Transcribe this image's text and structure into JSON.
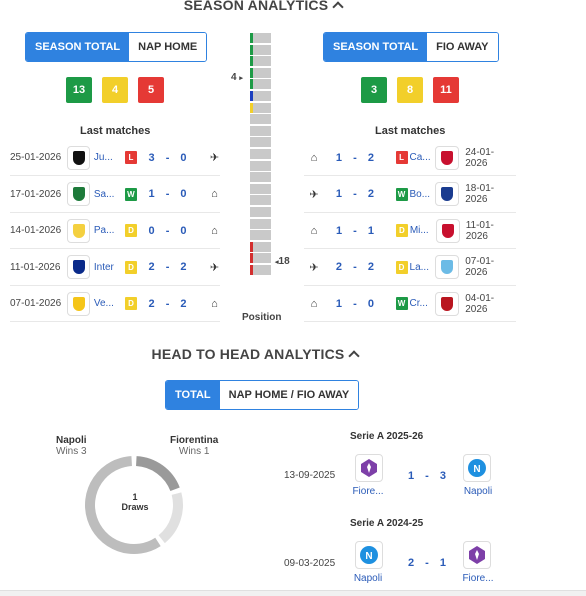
{
  "season": {
    "title": "SEASON ANALYTICS",
    "left": {
      "tabs": [
        "SEASON TOTAL",
        "NAP HOME"
      ],
      "badges": [
        {
          "value": "13",
          "color": "#1d9a46"
        },
        {
          "value": "4",
          "color": "#f2cf2a"
        },
        {
          "value": "5",
          "color": "#e53935"
        }
      ],
      "last_matches_label": "Last matches",
      "matches": [
        {
          "date": "25-01-2026",
          "team": "Ju...",
          "result": "L",
          "score": "3 - 0",
          "venue": "airplane-icon"
        },
        {
          "date": "17-01-2026",
          "team": "Sa...",
          "result": "W",
          "score": "1 - 0",
          "venue": "home-icon"
        },
        {
          "date": "14-01-2026",
          "team": "Pa...",
          "result": "D",
          "score": "0 - 0",
          "venue": "home-icon"
        },
        {
          "date": "11-01-2026",
          "team": "Inter",
          "result": "D",
          "score": "2 - 2",
          "venue": "airplane-icon"
        },
        {
          "date": "07-01-2026",
          "team": "Ve...",
          "result": "D",
          "score": "2 - 2",
          "venue": "home-icon"
        }
      ]
    },
    "right": {
      "tabs": [
        "SEASON TOTAL",
        "FIO AWAY"
      ],
      "badges": [
        {
          "value": "3",
          "color": "#1d9a46"
        },
        {
          "value": "8",
          "color": "#f2cf2a"
        },
        {
          "value": "11",
          "color": "#e53935"
        }
      ],
      "last_matches_label": "Last matches",
      "matches": [
        {
          "date": "24-01-2026",
          "team": "Ca...",
          "result": "L",
          "score": "1 - 2",
          "venue": "home-icon"
        },
        {
          "date": "18-01-2026",
          "team": "Bo...",
          "result": "W",
          "score": "1 - 2",
          "venue": "airplane-icon"
        },
        {
          "date": "11-01-2026",
          "team": "Mi...",
          "result": "D",
          "score": "1 - 1",
          "venue": "home-icon"
        },
        {
          "date": "07-01-2026",
          "team": "La...",
          "result": "D",
          "score": "2 - 2",
          "venue": "airplane-icon"
        },
        {
          "date": "04-01-2026",
          "team": "Cr...",
          "result": "W",
          "score": "1 - 0",
          "venue": "home-icon"
        }
      ]
    },
    "position": {
      "label": "Position",
      "marker_top": "4",
      "marker_bottom": "18",
      "bars": [
        "green",
        "green",
        "green",
        "green",
        "green",
        "blue",
        "yellow",
        "none",
        "none",
        "none",
        "none",
        "none",
        "none",
        "none",
        "none",
        "none",
        "none",
        "none",
        "red",
        "red",
        "red"
      ]
    }
  },
  "h2h": {
    "title": "HEAD TO HEAD ANALYTICS",
    "tabs": [
      "TOTAL",
      "NAP HOME / FIO AWAY"
    ],
    "home": {
      "name": "Napoli",
      "wins": "Wins 3"
    },
    "away": {
      "name": "Fiorentina",
      "wins": "Wins 1"
    },
    "draws": {
      "count": "1",
      "label": "Draws"
    },
    "ring": {
      "home_wins": 3,
      "draws": 1,
      "away_wins": 1
    },
    "fixtures": [
      {
        "competition": "Serie A 2025-26",
        "date": "13-09-2025",
        "home": "Fiore...",
        "score": "1 - 3",
        "away": "Napoli"
      },
      {
        "competition": "Serie A 2024-25",
        "date": "09-03-2025",
        "home": "Napoli",
        "score": "2 - 1",
        "away": "Fiore..."
      }
    ]
  },
  "colors": {
    "accent": "#2f82e0",
    "win": "#1d9a46",
    "draw": "#f2cf2a",
    "loss": "#e53935",
    "link": "#2a5bb8"
  }
}
